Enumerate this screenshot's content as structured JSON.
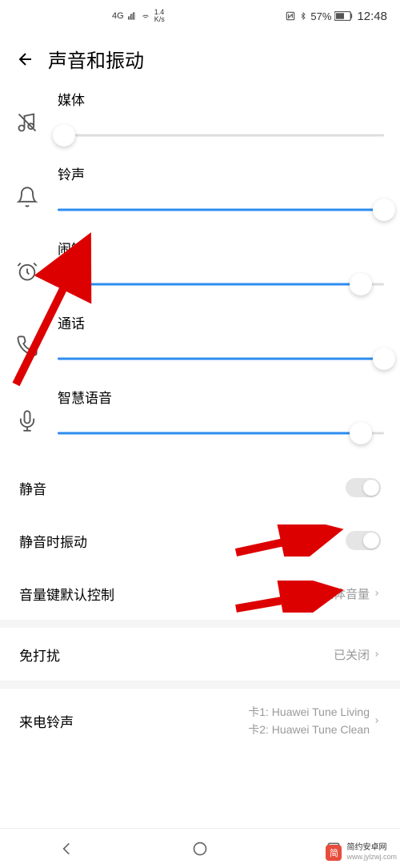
{
  "status": {
    "network_type": "4G",
    "speed": "1.4",
    "speed_unit": "K/s",
    "battery": "57%",
    "time": "12:48"
  },
  "header": {
    "title": "声音和振动"
  },
  "sliders": [
    {
      "label": "媒体",
      "value": 2
    },
    {
      "label": "铃声",
      "value": 100
    },
    {
      "label": "闹钟",
      "value": 93
    },
    {
      "label": "通话",
      "value": 100
    },
    {
      "label": "智慧语音",
      "value": 93
    }
  ],
  "toggles": {
    "silent": {
      "label": "静音",
      "on": false
    },
    "vibrate_on_silent": {
      "label": "静音时振动",
      "on": false
    }
  },
  "items": {
    "volume_key": {
      "label": "音量键默认控制",
      "value": "媒体音量"
    },
    "dnd": {
      "label": "免打扰",
      "value": "已关闭"
    },
    "ringtone": {
      "label": "来电铃声",
      "line1": "卡1: Huawei Tune Living",
      "line2": "卡2: Huawei Tune Clean"
    }
  },
  "watermark": {
    "main": "简约安卓网",
    "sub": "www.jylzwj.com"
  }
}
